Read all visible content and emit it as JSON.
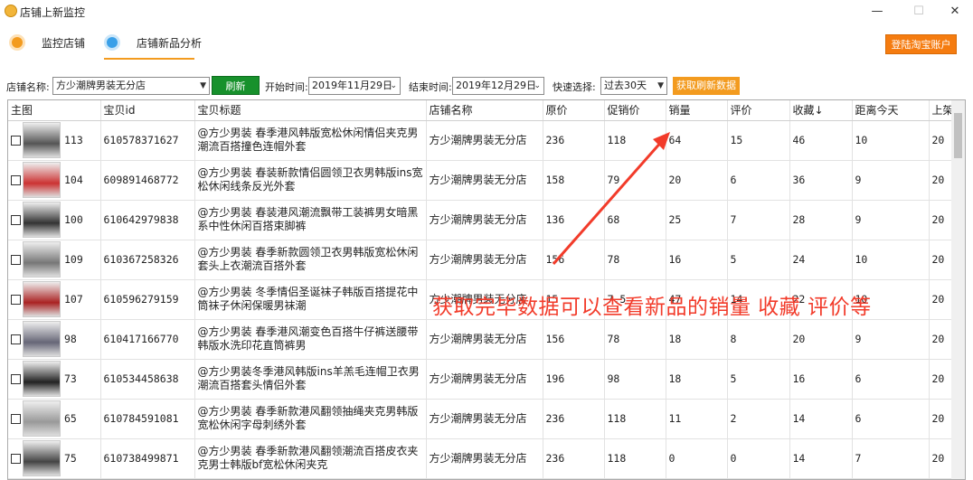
{
  "window": {
    "title": "店铺上新监控",
    "minimize": "—",
    "maximize": "☐",
    "close": "✕"
  },
  "nav": {
    "tabs": [
      {
        "label": "监控店铺",
        "icon": "store-icon",
        "color": "#f39b1f"
      },
      {
        "label": "店铺新品分析",
        "icon": "heart-icon",
        "color": "#3aa0e8"
      }
    ],
    "login_button": "登陆淘宝账户"
  },
  "filter": {
    "shop_label": "店铺名称:",
    "shop_value": "方少潮牌男装无分店",
    "refresh_button": "刷新",
    "start_label": "开始时间:",
    "start_value": "2019年11月29日",
    "end_label": "结束时间:",
    "end_value": "2019年12月29日",
    "quick_label": "快速选择:",
    "quick_value": "过去30天",
    "fetch_button": "获取刷新数据"
  },
  "table": {
    "headers": [
      "主图",
      "宝贝id",
      "宝贝标题",
      "店铺名称",
      "原价",
      "促销价",
      "销量",
      "评价",
      "收藏↓",
      "距离今天",
      "上架"
    ],
    "rows": [
      {
        "idx": "113",
        "id": "610578371627",
        "title": "@方少男装 春季港风韩版宽松休闲情侣夹克男潮流百搭撞色连帽外套",
        "shop": "方少潮牌男装无分店",
        "price": "236",
        "promo": "118",
        "sales": "64",
        "reviews": "15",
        "favs": "46",
        "days": "10",
        "listed": "20"
      },
      {
        "idx": "104",
        "id": "609891468772",
        "title": "@方少男装 春装新款情侣圆领卫衣男韩版ins宽松休闲线条反光外套",
        "shop": "方少潮牌男装无分店",
        "price": "158",
        "promo": "79",
        "sales": "20",
        "reviews": "6",
        "favs": "36",
        "days": "9",
        "listed": "20"
      },
      {
        "idx": "100",
        "id": "610642979838",
        "title": "@方少男装 春装港风潮流飘带工装裤男女暗黑系中性休闲百搭束脚裤",
        "shop": "方少潮牌男装无分店",
        "price": "136",
        "promo": "68",
        "sales": "25",
        "reviews": "7",
        "favs": "28",
        "days": "9",
        "listed": "20"
      },
      {
        "idx": "109",
        "id": "610367258326",
        "title": "@方少男装 春季新款圆领卫衣男韩版宽松休闲套头上衣潮流百搭外套",
        "shop": "方少潮牌男装无分店",
        "price": "156",
        "promo": "78",
        "sales": "16",
        "reviews": "5",
        "favs": "24",
        "days": "10",
        "listed": "20"
      },
      {
        "idx": "107",
        "id": "610596279159",
        "title": "@方少男装 冬季情侣圣诞袜子韩版百搭提花中筒袜子休闲保暖男袜潮",
        "shop": "方少潮牌男装无分店",
        "price": "15",
        "promo": "7.5",
        "sales": "47",
        "reviews": "14",
        "favs": "22",
        "days": "10",
        "listed": "20"
      },
      {
        "idx": "98",
        "id": "610417166770",
        "title": "@方少男装 春季港风潮变色百搭牛仔裤送腰带韩版水洗印花直筒裤男",
        "shop": "方少潮牌男装无分店",
        "price": "156",
        "promo": "78",
        "sales": "18",
        "reviews": "8",
        "favs": "20",
        "days": "9",
        "listed": "20"
      },
      {
        "idx": "73",
        "id": "610534458638",
        "title": "@方少男装冬季港风韩版ins羊羔毛连帽卫衣男潮流百搭套头情侣外套",
        "shop": "方少潮牌男装无分店",
        "price": "196",
        "promo": "98",
        "sales": "18",
        "reviews": "5",
        "favs": "16",
        "days": "6",
        "listed": "20"
      },
      {
        "idx": "65",
        "id": "610784591081",
        "title": "@方少男装 春季新款港风翻领抽绳夹克男韩版宽松休闲字母刺绣外套",
        "shop": "方少潮牌男装无分店",
        "price": "236",
        "promo": "118",
        "sales": "11",
        "reviews": "2",
        "favs": "14",
        "days": "6",
        "listed": "20"
      },
      {
        "idx": "75",
        "id": "610738499871",
        "title": "@方少男装 春季新款港风翻领潮流百搭皮衣夹克男士韩版bf宽松休闲夹克",
        "shop": "方少潮牌男装无分店",
        "price": "236",
        "promo": "118",
        "sales": "0",
        "reviews": "0",
        "favs": "14",
        "days": "7",
        "listed": "20"
      }
    ]
  },
  "annotation": "获取完毕数据可以查看新品的销量 收藏  评价等",
  "colors": {
    "accent_orange": "#f39b1f",
    "refresh_green": "#17912c",
    "annotation_red": "#f23b2a"
  }
}
